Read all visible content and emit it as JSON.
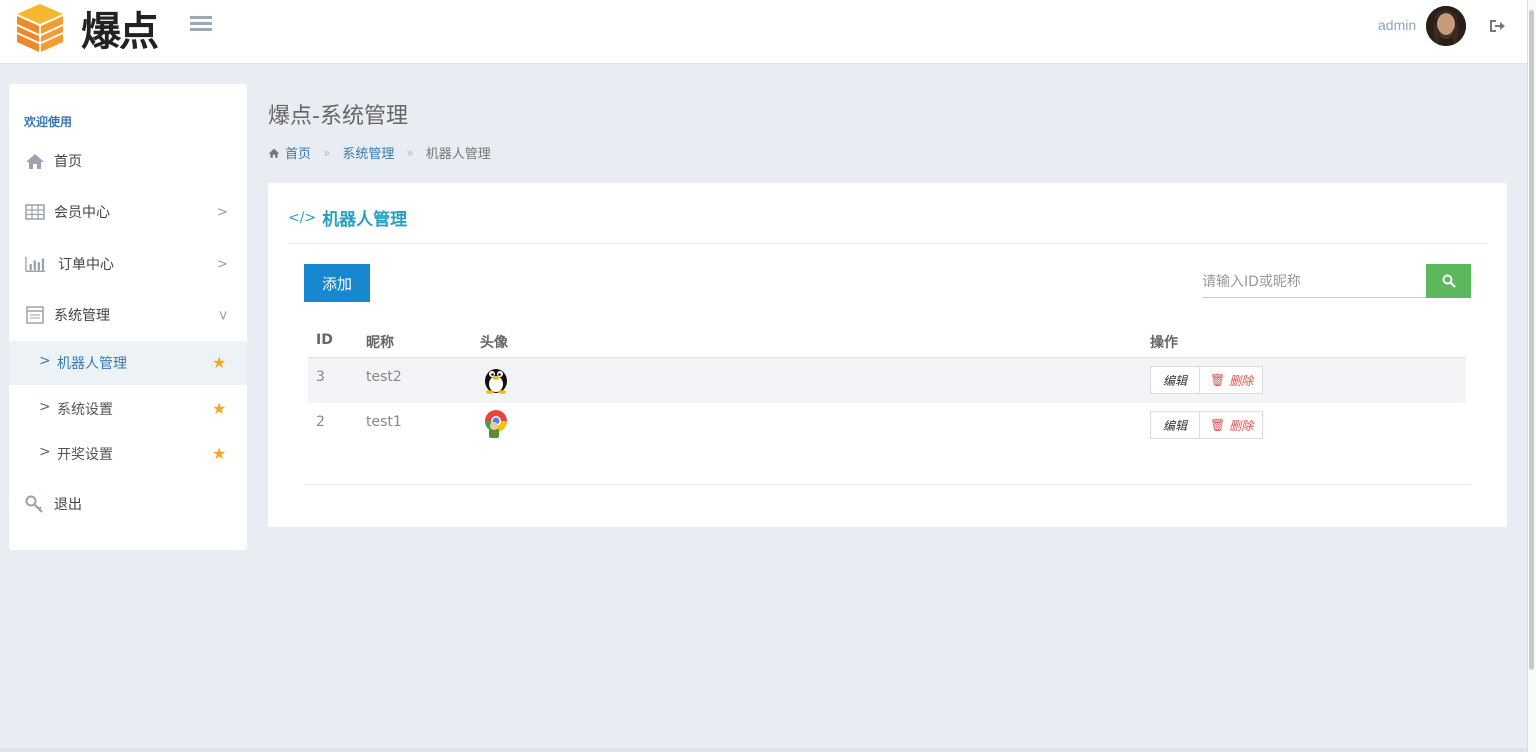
{
  "header": {
    "logo_text": "爆点",
    "user_name": "admin"
  },
  "sidebar": {
    "welcome": "欢迎使用",
    "items": [
      {
        "label": "首页",
        "icon": "home-icon"
      },
      {
        "label": "会员中心",
        "icon": "table-icon"
      },
      {
        "label": "订单中心",
        "icon": "bar-chart-icon"
      },
      {
        "label": "系统管理",
        "icon": "calendar-icon"
      },
      {
        "label": "退出",
        "icon": "key-icon"
      }
    ],
    "sub_items": [
      {
        "label": "机器人管理",
        "active": true
      },
      {
        "label": "系统设置",
        "active": false
      },
      {
        "label": "开奖设置",
        "active": false
      }
    ]
  },
  "page": {
    "title": "爆点-系统管理",
    "breadcrumb": [
      "首页",
      "系统管理",
      "机器人管理"
    ],
    "breadcrumb_sep": "»"
  },
  "card": {
    "title": "机器人管理",
    "add_label": "添加",
    "search_placeholder": "请输入ID或昵称",
    "columns": [
      "ID",
      "昵称",
      "头像",
      "操作"
    ],
    "rows": [
      {
        "id": "3",
        "nickname": "test2",
        "avatar": "penguin-avatar"
      },
      {
        "id": "2",
        "nickname": "test1",
        "avatar": "colorful-avatar"
      }
    ],
    "edit_label": "编辑",
    "delete_label": "删除"
  },
  "colors": {
    "primary": "#1787cf",
    "success": "#5cb85c",
    "danger": "#d9534f",
    "accent_title": "#2aa0bf",
    "link": "#3a79b0",
    "star": "#f5a623",
    "background": "#e8ecf3"
  }
}
